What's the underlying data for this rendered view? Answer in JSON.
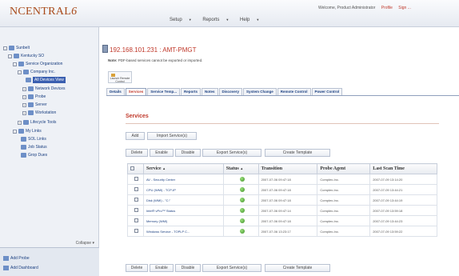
{
  "app": {
    "logo": "NCENTRAL",
    "logo_version": "6"
  },
  "header": {
    "welcome": "Welcome, Product Administrator",
    "profile_link": "Profile",
    "signout_link": "Sign ...",
    "nav": [
      "Setup",
      "Reports",
      "Help"
    ]
  },
  "sidebar": {
    "items": [
      "Sunbelt",
      "Kentucky SO",
      "Service Organization",
      "Company Inc.",
      "All Devices View",
      "Network Devices",
      "Probe",
      "Server",
      "Workstation",
      "Lifecycle Tools",
      "My Links",
      "SOL Links",
      "Job Status",
      "Grop Dues"
    ],
    "collapse_label": "Collapse",
    "add_probe": "Add Probe",
    "add_dashboard": "Add Dashboard"
  },
  "device": {
    "title": "192.168.101.231 : AMT-PMGT",
    "notice_prefix": "Note:",
    "notice": "PDF-based services cannot be exported or imported.",
    "launch_label": "Launch Remote Control"
  },
  "tabs": [
    "Details",
    "Services",
    "Service Temp...",
    "Reports",
    "Notes",
    "Discovery",
    "System Change",
    "Remote Control",
    "Power Control"
  ],
  "services": {
    "heading": "Services",
    "top_buttons": [
      "Add",
      "Import Service(s)"
    ],
    "action_buttons": [
      "Delete",
      "Enable",
      "Disable",
      "Export Service(s)",
      "Create Template"
    ],
    "columns": [
      "Service",
      "Status",
      "Transition",
      "Probe Agent",
      "Last Scan Time"
    ],
    "sort_indicator": "▲",
    "rows": [
      {
        "service": "AV - Security Center",
        "transition": "2007-07-06 09:47:18",
        "probe": "Complex-Inc.",
        "last_scan": "2007-07-09 13:14:20"
      },
      {
        "service": "CPU (WMI) - TCP-IP",
        "transition": "2007-07-06 09:47:18",
        "probe": "Complex-Inc.",
        "last_scan": "2007-07-09 13:44:21"
      },
      {
        "service": "Disk (WMI) - \"C:\"",
        "transition": "2007-07-06 09:47:18",
        "probe": "Complex-Inc.",
        "last_scan": "2007-07-09 13:44:19"
      },
      {
        "service": "Intel® vPro™ Status",
        "transition": "2007-07-06 09:47:14",
        "probe": "Complex-Inc.",
        "last_scan": "2007-07-09 13:59:18"
      },
      {
        "service": "Memory (WMI)",
        "transition": "2007-07-06 09:47:18",
        "probe": "Complex-Inc.",
        "last_scan": "2007-07-09 13:44:23"
      },
      {
        "service": "Windows Service - TOPLP C...",
        "transition": "2007-07-06 13:23:17",
        "probe": "Complex-Inc.",
        "last_scan": "2007-07-09 13:59:22"
      }
    ]
  }
}
